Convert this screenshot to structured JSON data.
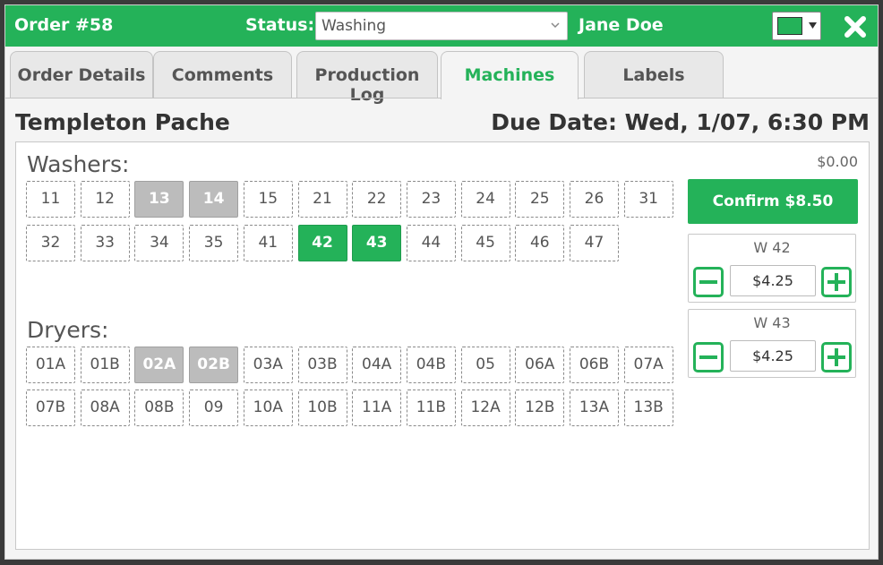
{
  "header": {
    "order_title": "Order #58",
    "status_label": "Status:",
    "status_value": "Washing",
    "customer": "Jane Doe",
    "tag_color": "#24b259"
  },
  "tabs": [
    {
      "label": "Order Details",
      "active": false
    },
    {
      "label": "Comments",
      "active": false
    },
    {
      "label": "Production Log",
      "active": false
    },
    {
      "label": "Machines",
      "active": true
    },
    {
      "label": "Labels",
      "active": false
    }
  ],
  "content": {
    "customer_title": "Templeton Pache",
    "due_date": "Due Date: Wed, 1/07, 6:30 PM"
  },
  "washers": {
    "label": "Washers:",
    "rows": [
      [
        {
          "id": "11",
          "state": "free"
        },
        {
          "id": "12",
          "state": "free"
        },
        {
          "id": "13",
          "state": "busy"
        },
        {
          "id": "14",
          "state": "busy"
        },
        {
          "id": "15",
          "state": "free"
        },
        {
          "id": "21",
          "state": "free"
        },
        {
          "id": "22",
          "state": "free"
        },
        {
          "id": "23",
          "state": "free"
        },
        {
          "id": "24",
          "state": "free"
        },
        {
          "id": "25",
          "state": "free"
        },
        {
          "id": "26",
          "state": "free"
        },
        {
          "id": "31",
          "state": "free"
        }
      ],
      [
        {
          "id": "32",
          "state": "free"
        },
        {
          "id": "33",
          "state": "free"
        },
        {
          "id": "34",
          "state": "free"
        },
        {
          "id": "35",
          "state": "free"
        },
        {
          "id": "41",
          "state": "free"
        },
        {
          "id": "42",
          "state": "selected"
        },
        {
          "id": "43",
          "state": "selected"
        },
        {
          "id": "44",
          "state": "free"
        },
        {
          "id": "45",
          "state": "free"
        },
        {
          "id": "46",
          "state": "free"
        },
        {
          "id": "47",
          "state": "free"
        }
      ]
    ]
  },
  "dryers": {
    "label": "Dryers:",
    "rows": [
      [
        {
          "id": "01A",
          "state": "free"
        },
        {
          "id": "01B",
          "state": "free"
        },
        {
          "id": "02A",
          "state": "busy"
        },
        {
          "id": "02B",
          "state": "busy"
        },
        {
          "id": "03A",
          "state": "free"
        },
        {
          "id": "03B",
          "state": "free"
        },
        {
          "id": "04A",
          "state": "free"
        },
        {
          "id": "04B",
          "state": "free"
        },
        {
          "id": "05",
          "state": "free"
        },
        {
          "id": "06A",
          "state": "free"
        },
        {
          "id": "06B",
          "state": "free"
        },
        {
          "id": "07A",
          "state": "free"
        }
      ],
      [
        {
          "id": "07B",
          "state": "free"
        },
        {
          "id": "08A",
          "state": "free"
        },
        {
          "id": "08B",
          "state": "free"
        },
        {
          "id": "09",
          "state": "free"
        },
        {
          "id": "10A",
          "state": "free"
        },
        {
          "id": "10B",
          "state": "free"
        },
        {
          "id": "11A",
          "state": "free"
        },
        {
          "id": "11B",
          "state": "free"
        },
        {
          "id": "12A",
          "state": "free"
        },
        {
          "id": "12B",
          "state": "free"
        },
        {
          "id": "13A",
          "state": "free"
        },
        {
          "id": "13B",
          "state": "free"
        }
      ]
    ]
  },
  "cart": {
    "balance": "$0.00",
    "confirm_label": "Confirm $8.50",
    "items": [
      {
        "label": "W 42",
        "price": "$4.25"
      },
      {
        "label": "W 43",
        "price": "$4.25"
      }
    ]
  },
  "colors": {
    "accent": "#24b259",
    "busy": "#bcbcbc"
  }
}
